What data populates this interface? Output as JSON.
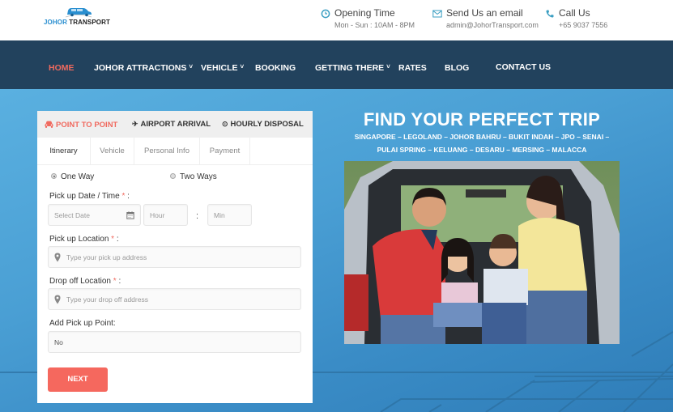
{
  "brand": {
    "name_part1": "JOHOR",
    "name_part2": " TRANSPORT"
  },
  "header": {
    "opening": {
      "icon": "clock-icon",
      "title": "Opening Time",
      "value": "Mon - Sun : 10AM - 8PM"
    },
    "email": {
      "icon": "envelope-icon",
      "title": "Send Us an email",
      "value": "admin@JohorTransport.com"
    },
    "call": {
      "icon": "phone-icon",
      "title": "Call Us",
      "value": "+65 9037 7556"
    }
  },
  "nav": {
    "items": [
      {
        "label": "HOME",
        "active": true,
        "dropdown": false
      },
      {
        "label": "JOHOR ATTRACTIONS",
        "dropdown": true
      },
      {
        "label": "VEHICLE",
        "dropdown": true
      },
      {
        "label": "BOOKING",
        "dropdown": false
      },
      {
        "label": "GETTING THERE",
        "dropdown": true
      },
      {
        "label": "RATES",
        "dropdown": false
      },
      {
        "label": "BLOG",
        "dropdown": false
      },
      {
        "label": "CONTACT US",
        "dropdown": false
      }
    ],
    "chevron": "˅"
  },
  "booking": {
    "service_tabs": [
      {
        "label": "POINT TO POINT",
        "icon": "car-icon",
        "glyph": "🚘",
        "active": true
      },
      {
        "label": "AIRPORT ARRIVAL",
        "icon": "plane-icon",
        "glyph": "✈"
      },
      {
        "label": "HOURLY DISPOSAL",
        "icon": "clock-icon",
        "glyph": "⊙"
      }
    ],
    "steps": [
      {
        "label": "Itinerary",
        "active": true
      },
      {
        "label": "Vehicle"
      },
      {
        "label": "Personal Info"
      },
      {
        "label": "Payment"
      }
    ],
    "trip_type": {
      "options": [
        "One Way",
        "Two Ways"
      ],
      "selected": "One Way"
    },
    "pickup_datetime": {
      "label": "Pick up Date / Time",
      "required_mark": "*",
      "suffix": " :",
      "date_placeholder": "Select Date",
      "hour_placeholder": "Hour",
      "min_placeholder": "Min",
      "separator": ":"
    },
    "pickup_location": {
      "label": "Pick up Location",
      "required_mark": "*",
      "suffix": " :",
      "placeholder": "Type your pick up address"
    },
    "dropoff_location": {
      "label": "Drop off Location",
      "required_mark": "*",
      "suffix": " :",
      "placeholder": "Type your drop off address"
    },
    "add_pickup_point": {
      "label": "Add Pick up Point:",
      "value": "No"
    },
    "next_label": "NEXT"
  },
  "hero": {
    "title": "FIND YOUR PERFECT TRIP",
    "destinations_line1": "SINGAPORE – LEGOLAND – JOHOR BAHRU – BUKIT INDAH – JPO – SENAI –",
    "destinations_line2": "PULAI SPRING – KELUANG – DESARU – MERSING – MALACCA",
    "image_description": "Family of four sitting in the open trunk of a car"
  },
  "colors": {
    "accent": "#f06a5f",
    "nav_bg": "#22425d",
    "hero_blue": "#4a9fd4",
    "brand_blue": "#2a8fd0",
    "icon_teal": "#3a9ec2"
  }
}
